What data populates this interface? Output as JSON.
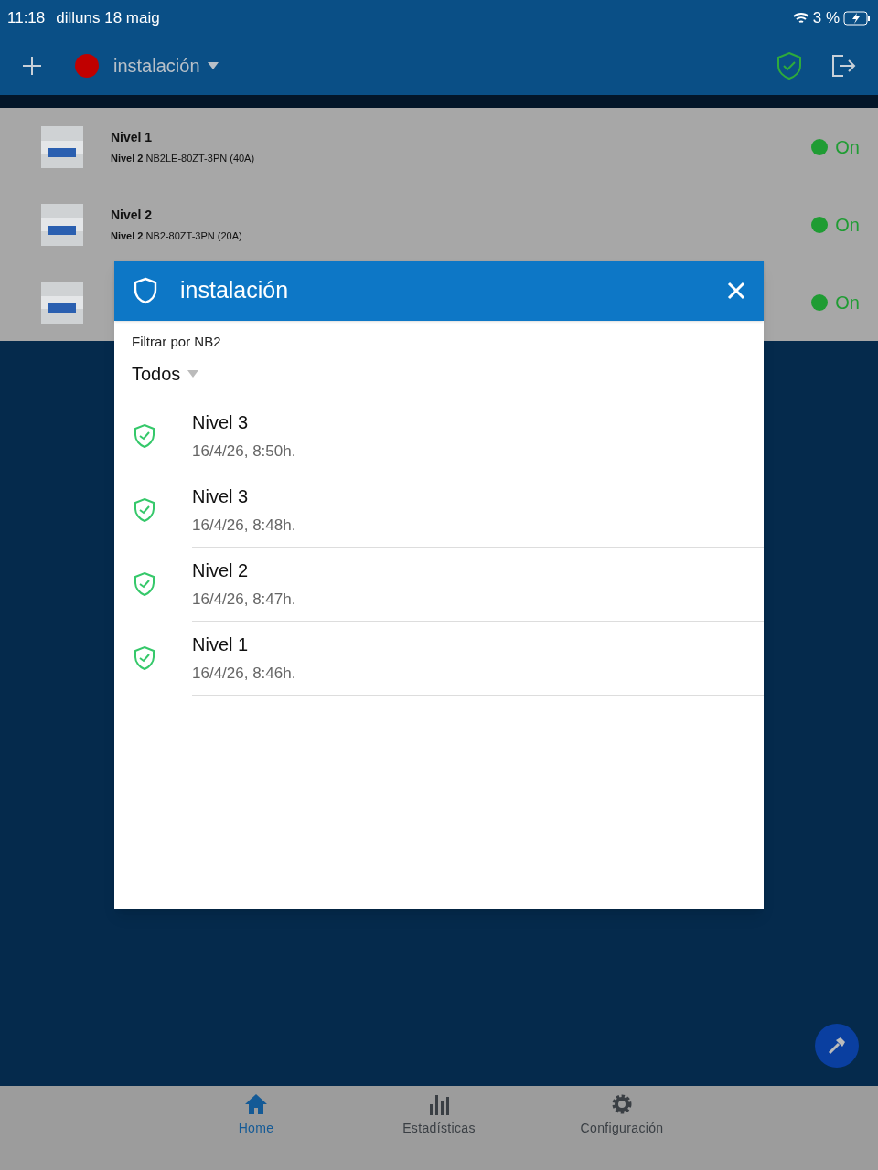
{
  "status_bar": {
    "time": "11:18",
    "date": "dilluns 18 maig",
    "battery": "3 %"
  },
  "header": {
    "site": "instalación",
    "online": false
  },
  "devices": [
    {
      "name": "Nivel 1",
      "label": "Nivel 2",
      "model": "NB2LE-80ZT-3PN (40A)",
      "state": "On",
      "on": true
    },
    {
      "name": "Nivel 2",
      "label": "Nivel 2",
      "model": "NB2-80ZT-3PN (20A)",
      "state": "On",
      "on": true
    },
    {
      "state": "On",
      "on": true
    }
  ],
  "dialog": {
    "title": "instalación",
    "filter_label": "Filtrar por NB2",
    "filter_value": "Todos",
    "events": [
      {
        "title": "Nivel 3",
        "time": "16/4/26, 8:50h."
      },
      {
        "title": "Nivel 3",
        "time": "16/4/26, 8:48h."
      },
      {
        "title": "Nivel 2",
        "time": "16/4/26, 8:47h."
      },
      {
        "title": "Nivel 1",
        "time": "16/4/26, 8:46h."
      }
    ]
  },
  "tabs": [
    {
      "label": "Home",
      "selected": true
    },
    {
      "label": "Estadísticas",
      "selected": false
    },
    {
      "label": "Configuración",
      "selected": false
    }
  ]
}
